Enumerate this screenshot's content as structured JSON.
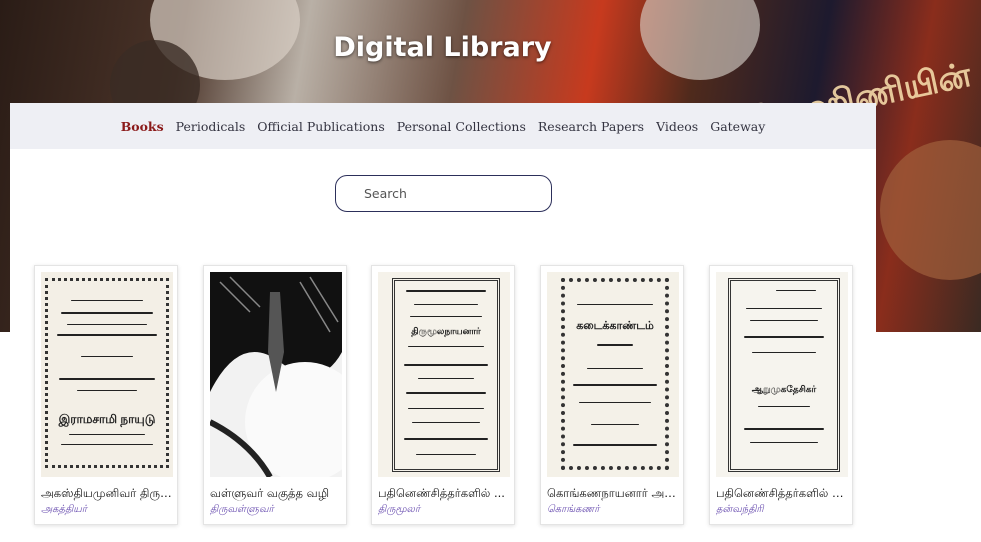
{
  "header": {
    "title": "Digital Library",
    "background_text": "ரோஹிணியின்"
  },
  "nav": {
    "items": [
      {
        "label": "Books",
        "active": true
      },
      {
        "label": "Periodicals",
        "active": false
      },
      {
        "label": "Official Publications",
        "active": false
      },
      {
        "label": "Personal Collections",
        "active": false
      },
      {
        "label": "Research Papers",
        "active": false
      },
      {
        "label": "Videos",
        "active": false
      },
      {
        "label": "Gateway",
        "active": false
      }
    ]
  },
  "search": {
    "placeholder": "Search",
    "value": ""
  },
  "books": [
    {
      "title": "அகஸ்தியமுனிவர் திருவா...",
      "author": "அகத்தியர்",
      "cover_text": "இராமசாமி நாயுடு"
    },
    {
      "title": "வள்ளுவர் வகுத்த வழி",
      "author": "திருவள்ளுவர்"
    },
    {
      "title": "பதினெண்சித்தர்களில் ...",
      "author": "திருமூலர்",
      "cover_text": "திருமூலநாயனார்"
    },
    {
      "title": "கொங்கணநாயனார் அரு...",
      "author": "கொங்கணர்",
      "cover_text": "கடைக்காண்டம்"
    },
    {
      "title": "பதினெண்சித்தர்களில் ம...",
      "author": "தன்வந்திரி",
      "cover_text": "ஆறுமுகதேசிகர்"
    }
  ],
  "colors": {
    "active_nav": "#8b1a1a",
    "author_link": "#6a4fb0",
    "nav_bg": "#eeeff4"
  }
}
